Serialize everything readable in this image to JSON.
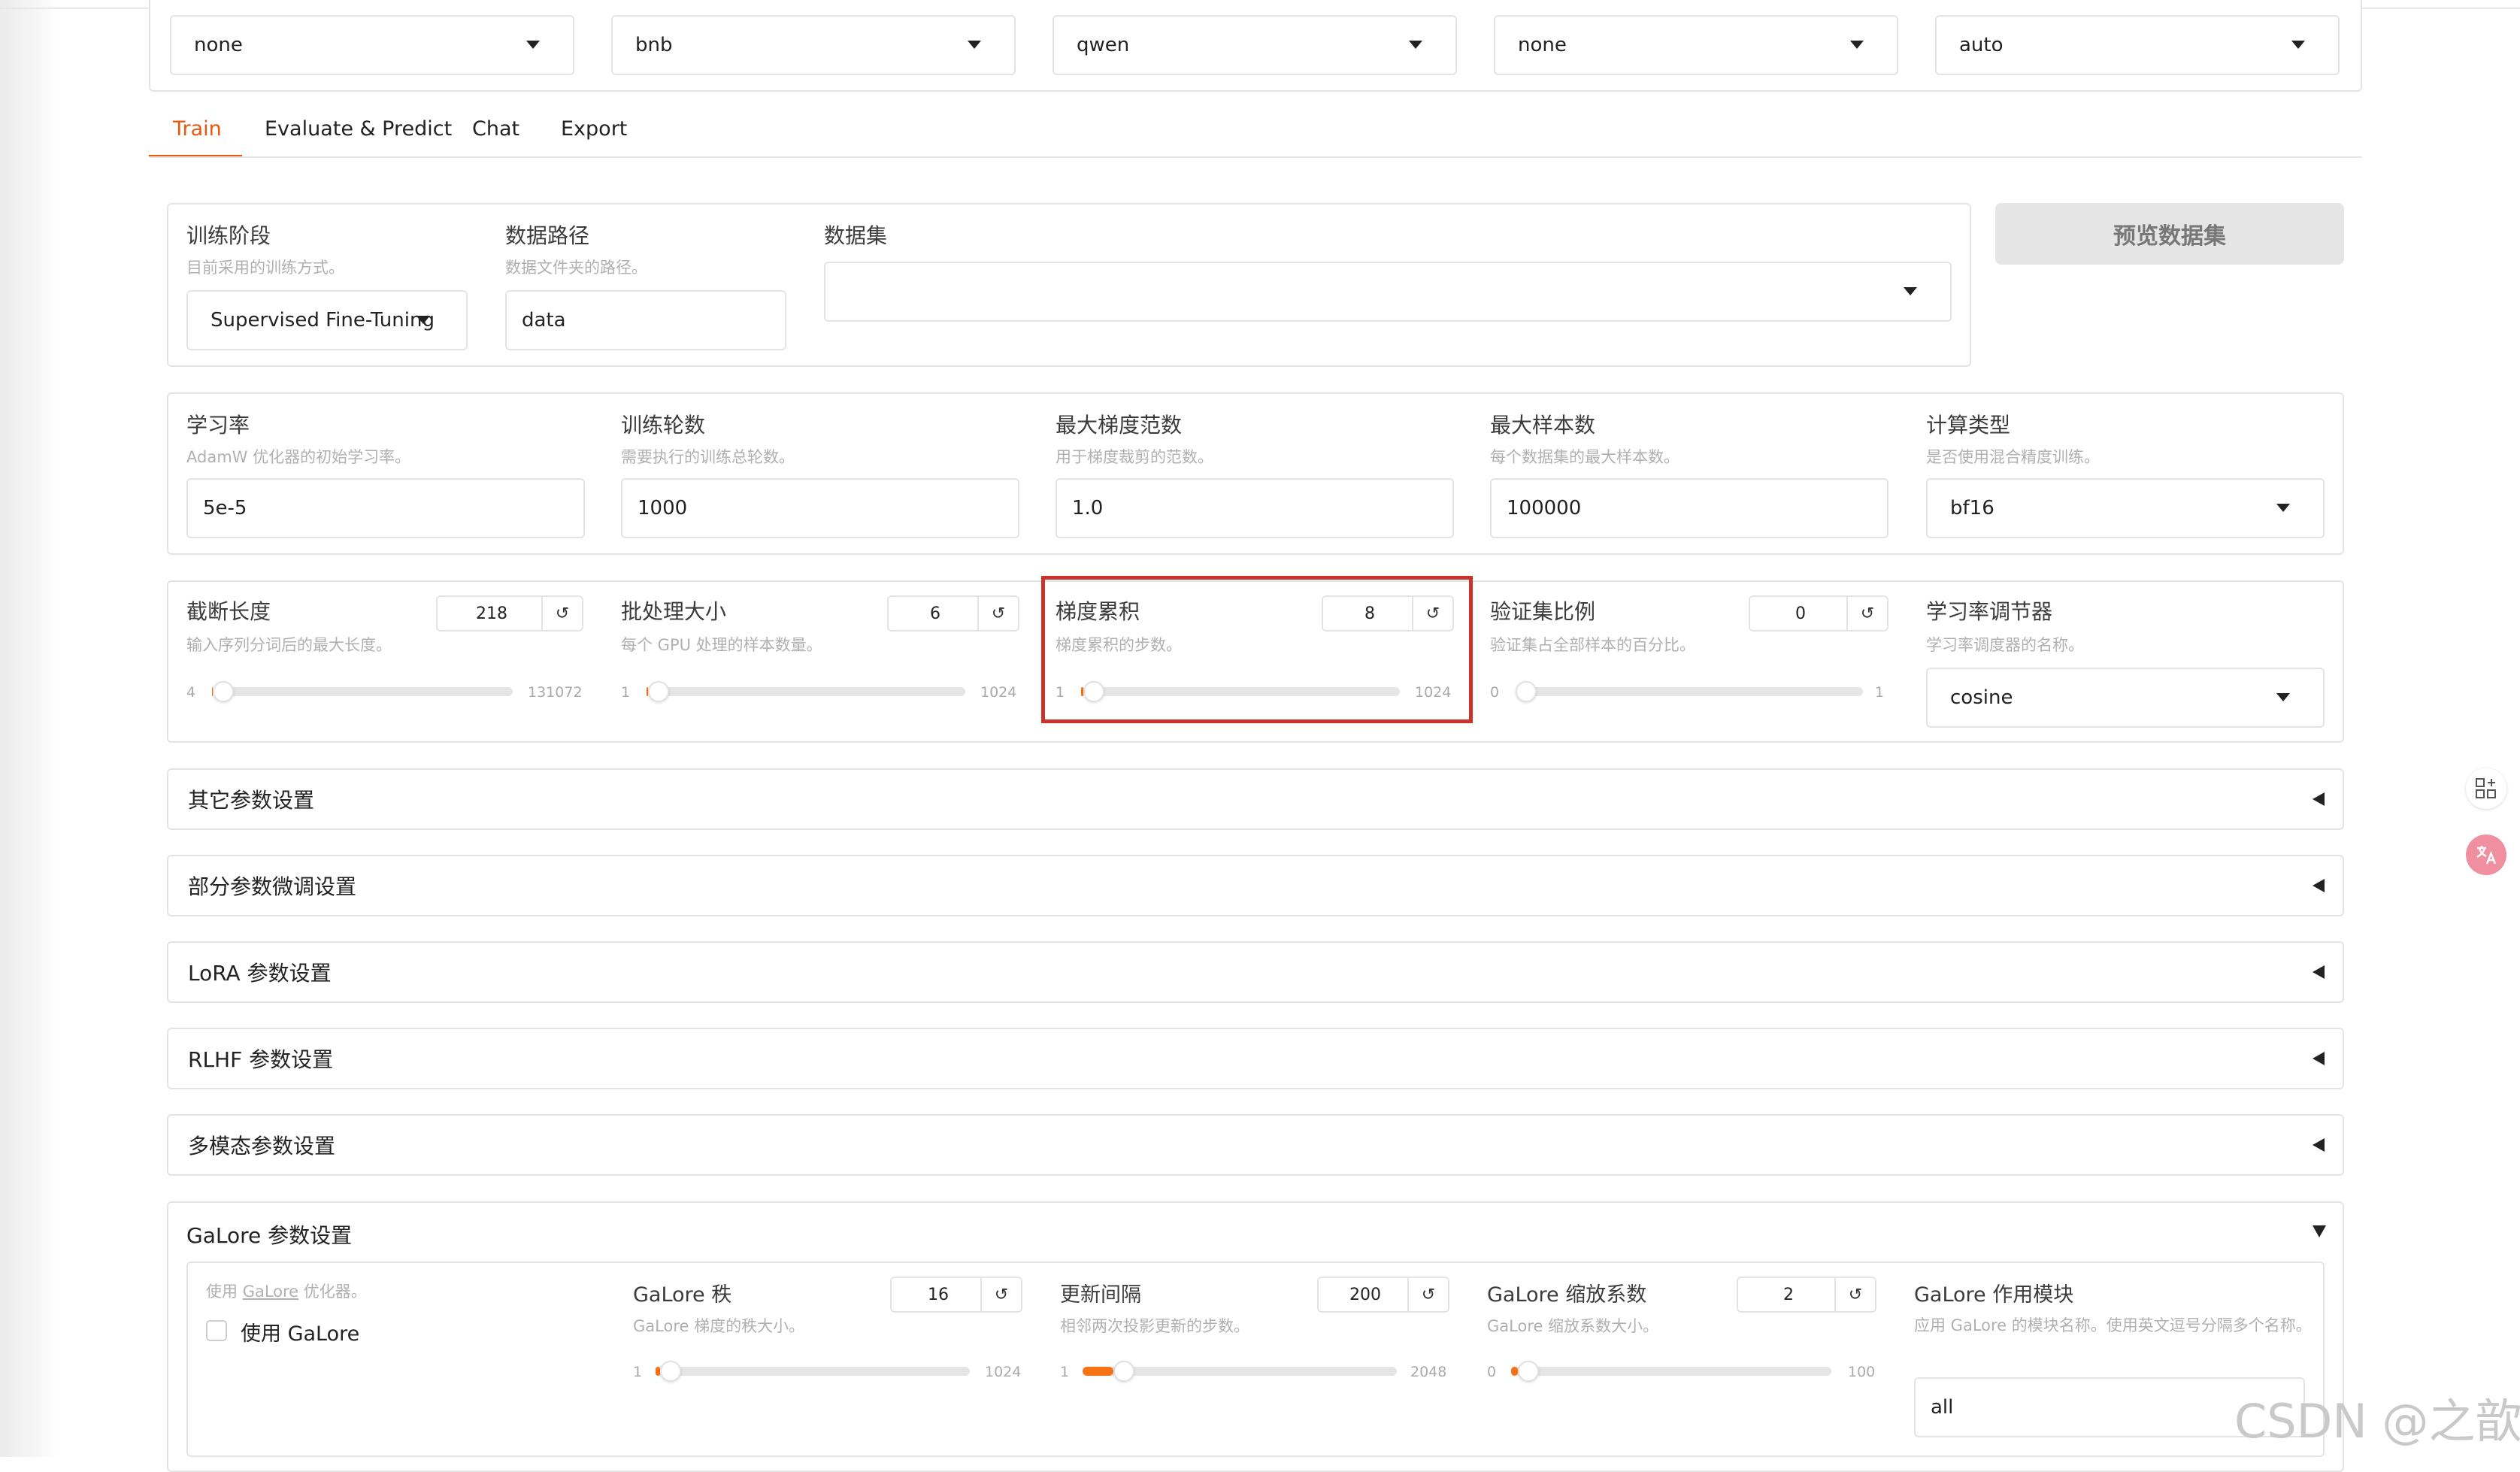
{
  "top_selects": [
    "none",
    "bnb",
    "qwen",
    "none",
    "auto"
  ],
  "tabs": [
    {
      "label": "Train",
      "active": true
    },
    {
      "label": "Evaluate & Predict",
      "active": false
    },
    {
      "label": "Chat",
      "active": false
    },
    {
      "label": "Export",
      "active": false
    }
  ],
  "data_section": {
    "stage": {
      "label": "训练阶段",
      "info": "目前采用的训练方式。",
      "value": "Supervised Fine-Tuning"
    },
    "dataset_dir": {
      "label": "数据路径",
      "info": "数据文件夹的路径。",
      "value": "data"
    },
    "dataset": {
      "label": "数据集",
      "value": ""
    },
    "preview_button": "预览数据集"
  },
  "row1": {
    "learning_rate": {
      "label": "学习率",
      "info": "AdamW 优化器的初始学习率。",
      "value": "5e-5"
    },
    "num_epochs": {
      "label": "训练轮数",
      "info": "需要执行的训练总轮数。",
      "value": "1000"
    },
    "max_grad_norm": {
      "label": "最大梯度范数",
      "info": "用于梯度裁剪的范数。",
      "value": "1.0"
    },
    "max_samples": {
      "label": "最大样本数",
      "info": "每个数据集的最大样本数。",
      "value": "100000"
    },
    "compute_type": {
      "label": "计算类型",
      "info": "是否使用混合精度训练。",
      "value": "bf16"
    }
  },
  "row2": {
    "cutoff_len": {
      "label": "截断长度",
      "info": "输入序列分词后的最大长度。",
      "value": "218",
      "min": "4",
      "max": "131072",
      "fraction": 0.002
    },
    "batch_size": {
      "label": "批处理大小",
      "info": "每个 GPU 处理的样本数量。",
      "value": "6",
      "min": "1",
      "max": "1024",
      "fraction": 0.005
    },
    "grad_accum": {
      "label": "梯度累积",
      "info": "梯度累积的步数。",
      "value": "8",
      "min": "1",
      "max": "1024",
      "fraction": 0.007
    },
    "val_size": {
      "label": "验证集比例",
      "info": "验证集占全部样本的百分比。",
      "value": "0",
      "min": "0",
      "max": "1",
      "fraction": 0.0
    },
    "lr_scheduler": {
      "label": "学习率调节器",
      "info": "学习率调度器的名称。",
      "value": "cosine"
    }
  },
  "accordions": [
    {
      "label": "其它参数设置",
      "open": false
    },
    {
      "label": "部分参数微调设置",
      "open": false
    },
    {
      "label": "LoRA 参数设置",
      "open": false
    },
    {
      "label": "RLHF 参数设置",
      "open": false
    },
    {
      "label": "多模态参数设置",
      "open": false
    },
    {
      "label": "GaLore 参数设置",
      "open": true
    }
  ],
  "galore": {
    "use_galore": {
      "info_prefix": "使用 ",
      "info_link": "GaLore",
      "info_suffix": " 优化器。",
      "label": "使用 GaLore",
      "checked": false
    },
    "rank": {
      "label": "GaLore 秩",
      "info": "GaLore 梯度的秩大小。",
      "value": "16",
      "min": "1",
      "max": "1024",
      "fraction": 0.015
    },
    "update_interval": {
      "label": "更新间隔",
      "info": "相邻两次投影更新的步数。",
      "value": "200",
      "min": "1",
      "max": "2048",
      "fraction": 0.098
    },
    "scale": {
      "label": "GaLore 缩放系数",
      "info": "GaLore 缩放系数大小。",
      "value": "2",
      "min": "0",
      "max": "100",
      "fraction": 0.02
    },
    "target": {
      "label": "GaLore 作用模块",
      "info": "应用 GaLore 的模块名称。使用英文逗号分隔多个名称。",
      "value": "all"
    }
  },
  "watermark": "CSDN @之歆",
  "colors": {
    "accent": "#f97316",
    "active_tab": "#ea580c",
    "highlight": "#c8342c"
  }
}
